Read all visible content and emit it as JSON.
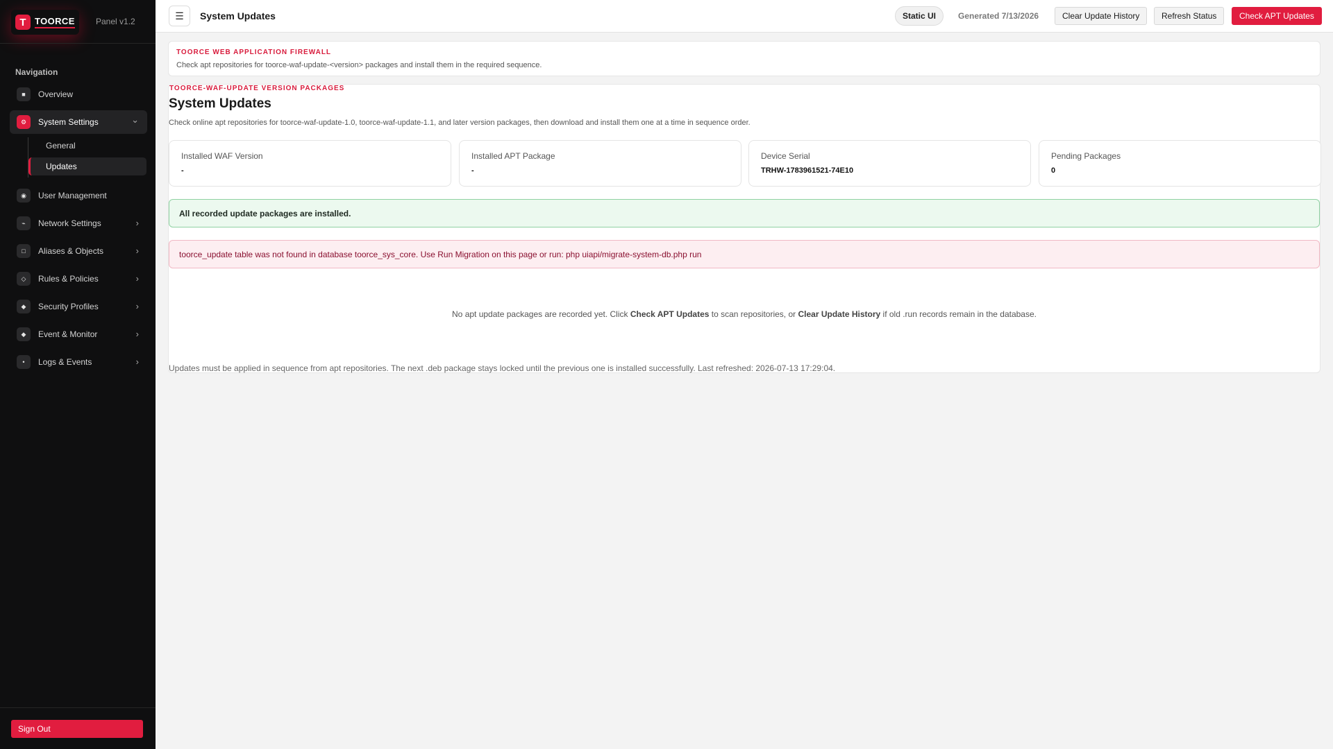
{
  "app": {
    "brand_initial": "T",
    "brand_name": "TOORCE",
    "panel_version": "Panel v1.2"
  },
  "sidebar": {
    "heading": "Navigation",
    "items": [
      {
        "label": "Overview",
        "icon": "grid-icon",
        "glyph": "■"
      },
      {
        "label": "System Settings",
        "icon": "gear-icon",
        "glyph": "⚙",
        "expanded": true
      },
      {
        "label": "User Management",
        "icon": "user-icon",
        "glyph": "◉"
      },
      {
        "label": "Network Settings",
        "icon": "network-icon",
        "glyph": "⌁"
      },
      {
        "label": "Aliases & Objects",
        "icon": "object-icon",
        "glyph": "□"
      },
      {
        "label": "Rules & Policies",
        "icon": "rules-icon",
        "glyph": "◇"
      },
      {
        "label": "Security Profiles",
        "icon": "shield-icon",
        "glyph": "◆"
      },
      {
        "label": "Event & Monitor",
        "icon": "monitor-icon",
        "glyph": "◆"
      },
      {
        "label": "Logs & Events",
        "icon": "logs-icon",
        "glyph": "•"
      }
    ],
    "sub_items": [
      {
        "label": "General"
      },
      {
        "label": "Updates",
        "active": true
      }
    ],
    "chevron_down": "⌄",
    "chevron_right": "›",
    "sign_out": "Sign Out"
  },
  "topbar": {
    "menu_glyph": "☰",
    "title": "System Updates",
    "static_badge": "Static UI",
    "generated": "Generated 7/13/2026",
    "clear_history": "Clear Update History",
    "refresh": "Refresh Status",
    "check_apt": "Check APT Updates"
  },
  "intro": {
    "eyebrow": "TOORCE WEB APPLICATION FIREWALL",
    "text": "Check apt repositories for toorce-waf-update-<version> packages and install them in the required sequence."
  },
  "main": {
    "eyebrow": "TOORCE-WAF-UPDATE VERSION PACKAGES",
    "title": "System Updates",
    "description": "Check online apt repositories for toorce-waf-update-1.0, toorce-waf-update-1.1, and later version packages, then download and install them one at a time in sequence order.",
    "stats": [
      {
        "label": "Installed WAF Version",
        "value": "-"
      },
      {
        "label": "Installed APT Package",
        "value": "-"
      },
      {
        "label": "Device Serial",
        "value": "TRHW-1783961521-74E10"
      },
      {
        "label": "Pending Packages",
        "value": "0"
      }
    ],
    "success_message": "All recorded update packages are installed.",
    "error_message": "toorce_update table was not found in database toorce_sys_core. Use Run Migration on this page or run: php uiapi/migrate-system-db.php run",
    "empty": {
      "part1": "No apt update packages are recorded yet. Click ",
      "bold1": "Check APT Updates",
      "part2": " to scan repositories, or ",
      "bold2": "Clear Update History",
      "part3": " if old .run records remain in the database."
    },
    "footer_note": "Updates must be applied in sequence from apt repositories. The next .deb package stays locked until the previous one is installed successfully. Last refreshed: 2026-07-13 17:29:04."
  },
  "colors": {
    "accent": "#e11d3f",
    "sidebar_bg": "#0f0f10",
    "success_bg": "#ecf9ef",
    "error_bg": "#fdeef1"
  }
}
